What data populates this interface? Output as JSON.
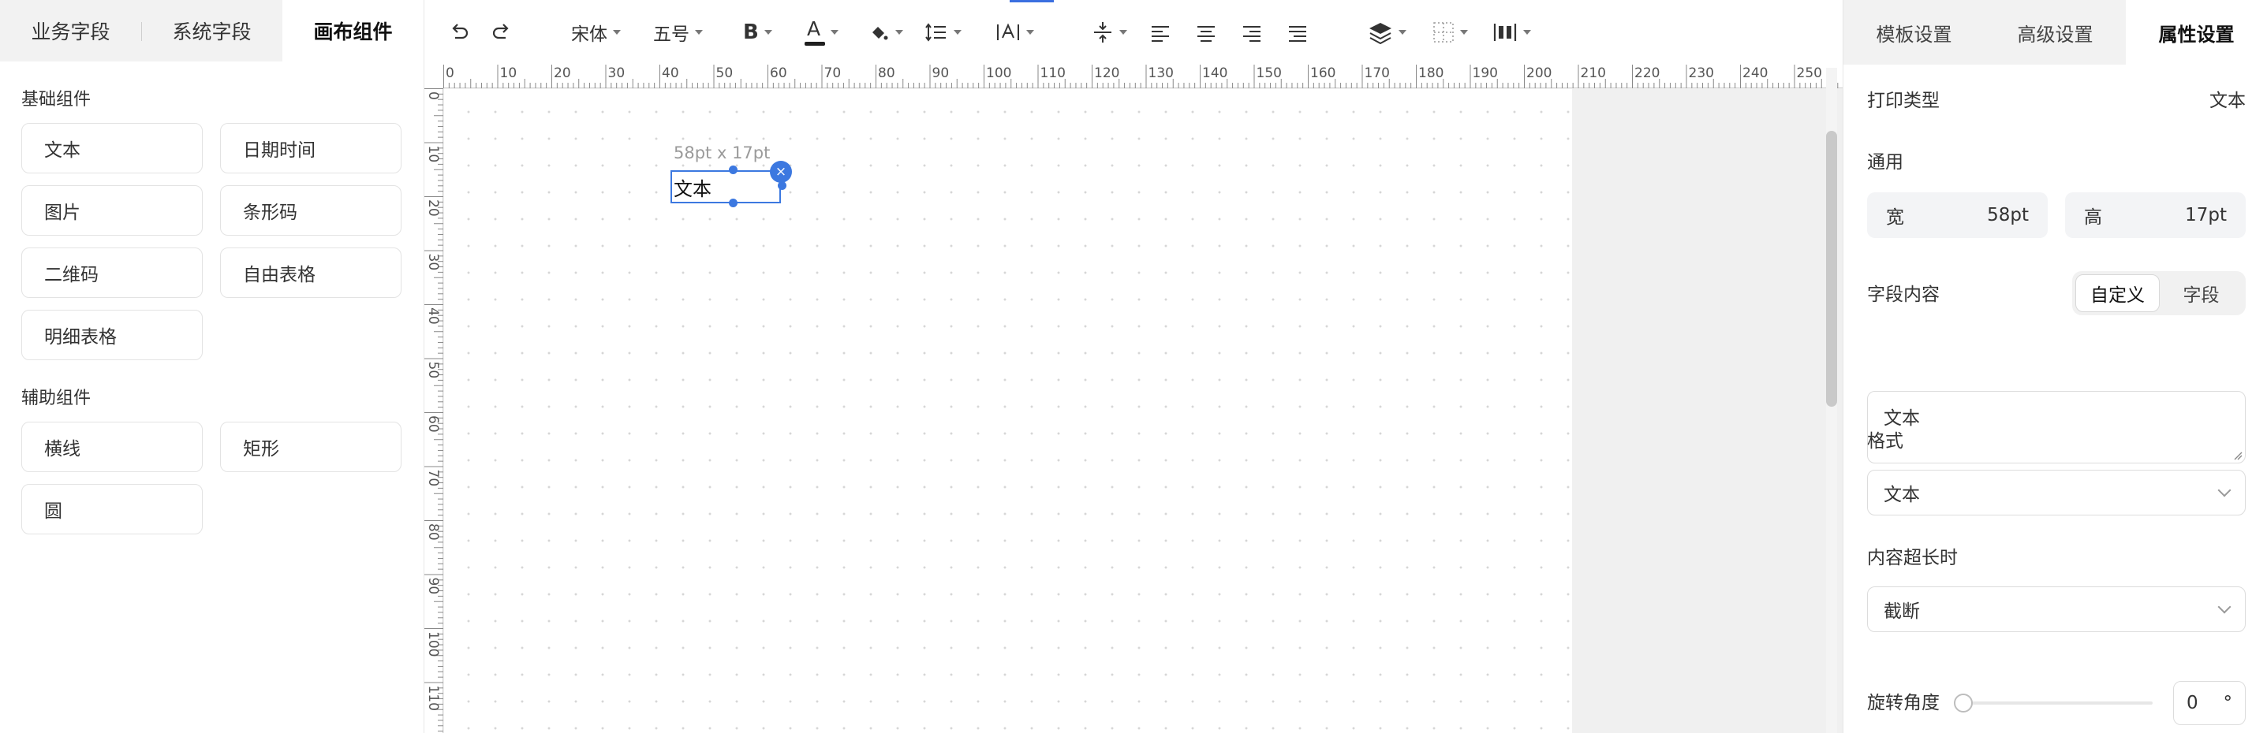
{
  "left_panel": {
    "tabs": [
      {
        "label": "业务字段",
        "active": false
      },
      {
        "label": "系统字段",
        "active": false
      },
      {
        "label": "画布组件",
        "active": true
      }
    ],
    "basic_section_title": "基础组件",
    "basic_components": [
      "文本",
      "日期时间",
      "图片",
      "条形码",
      "二维码",
      "自由表格",
      "明细表格"
    ],
    "aux_section_title": "辅助组件",
    "aux_components": [
      "横线",
      "矩形",
      "圆"
    ]
  },
  "toolbar": {
    "undo_icon": "undo-icon",
    "redo_icon": "redo-icon",
    "font_family": "宋体",
    "font_size": "五号",
    "bold_label": "B",
    "font_color_label": "A",
    "font_color": "#1f1f1f",
    "fill_icon": "paint-bucket-icon",
    "line_height_icon": "line-height-icon",
    "letter_spacing_icon": "letter-spacing-icon",
    "align_icons": [
      "vertical-center-icon",
      "align-left-icon",
      "align-center-icon",
      "align-right-icon",
      "align-justify-icon"
    ],
    "layer_icon": "layers-icon",
    "border_icon": "border-icon",
    "distribute_icon": "distribute-icon",
    "accent_color": "#3b6fe0"
  },
  "canvas": {
    "ruler_top_labels": [
      "0",
      "10",
      "20",
      "30",
      "40",
      "50",
      "60",
      "70",
      "80",
      "90",
      "100",
      "110",
      "120",
      "130",
      "140",
      "150",
      "160",
      "170",
      "180",
      "190",
      "200",
      "210",
      "220",
      "230",
      "240",
      "250"
    ],
    "ruler_left_labels": [
      "0",
      "10",
      "20",
      "30",
      "40",
      "50",
      "60",
      "70",
      "80",
      "90",
      "100",
      "110"
    ],
    "selected_element": {
      "size_label": "58pt x 17pt",
      "text": "文本",
      "close_label": "×"
    },
    "selection_color": "#3c78e0"
  },
  "right_panel": {
    "tabs": [
      {
        "label": "模板设置",
        "active": false
      },
      {
        "label": "高级设置",
        "active": false
      },
      {
        "label": "属性设置",
        "active": true
      }
    ],
    "print_type_label": "打印类型",
    "print_type_value": "文本",
    "general_label": "通用",
    "width_label": "宽",
    "width_value": "58pt",
    "height_label": "高",
    "height_value": "17pt",
    "field_content_label": "字段内容",
    "content_modes": [
      {
        "label": "自定义",
        "active": true
      },
      {
        "label": "字段",
        "active": false
      }
    ],
    "content_value": "文本",
    "format_label": "格式",
    "format_value": "文本",
    "overflow_label": "内容超长时",
    "overflow_value": "截断",
    "rotation_label": "旋转角度",
    "rotation_value": "0",
    "rotation_unit": "°",
    "rotation_fraction": 0
  }
}
